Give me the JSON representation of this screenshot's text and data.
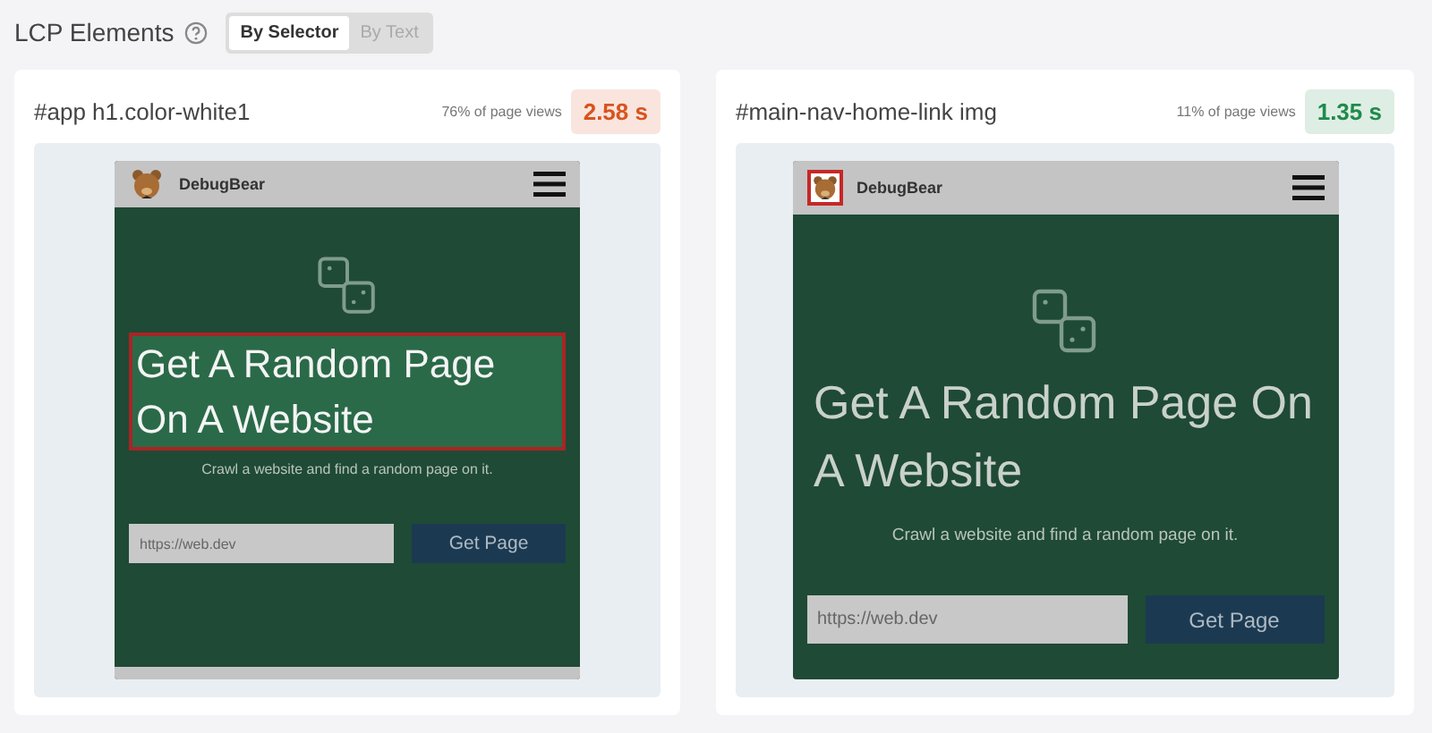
{
  "header": {
    "title": "LCP Elements",
    "toggle": [
      {
        "label": "By Selector",
        "selected": true
      },
      {
        "label": "By Text",
        "selected": false
      }
    ]
  },
  "elements": [
    {
      "selector": "#app h1.color-white1",
      "share": "76% of page views",
      "time": "2.58 s",
      "color": "#d9531e",
      "preview": {
        "brand": "DebugBear",
        "heading": "Get A Random Page On A Website",
        "subtitle": "Crawl a website and find a random page on it.",
        "placeholder": "https://web.dev",
        "button": "Get Page",
        "heading_highlighted": true,
        "logo_highlighted": false
      }
    },
    {
      "selector": "#main-nav-home-link img",
      "share": "11% of page views",
      "time": "1.35 s",
      "color": "#1f8a4c",
      "preview": {
        "brand": "DebugBear",
        "heading": "Get A Random Page On A Website",
        "subtitle": "Crawl a website and find a random page on it.",
        "placeholder": "https://web.dev",
        "button": "Get Page",
        "heading_highlighted": false,
        "logo_highlighted": true
      }
    }
  ]
}
